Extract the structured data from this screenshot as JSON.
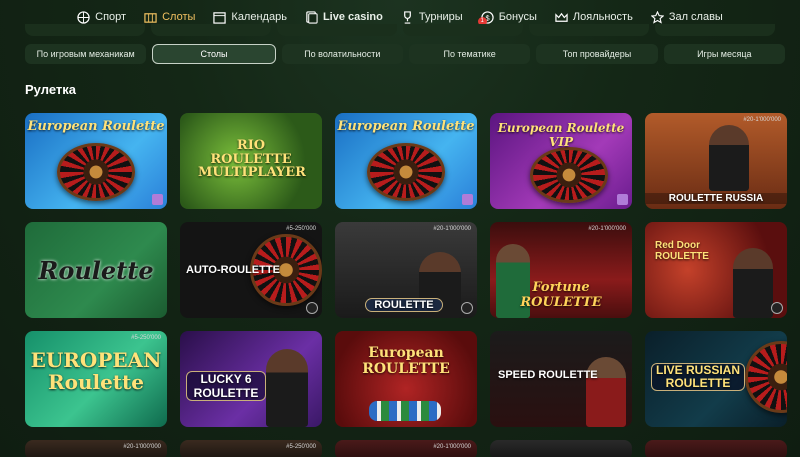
{
  "nav": {
    "items": [
      {
        "label": "Спорт",
        "icon": "ball-icon",
        "active": false
      },
      {
        "label": "Слоты",
        "icon": "slots-icon",
        "active": true
      },
      {
        "label": "Календарь",
        "icon": "calendar-icon",
        "active": false
      },
      {
        "label": "Live casino",
        "icon": "live-icon",
        "active": false,
        "bold": true
      },
      {
        "label": "Турниры",
        "icon": "trophy-icon",
        "active": false
      },
      {
        "label": "Бонусы",
        "icon": "bonus-icon",
        "active": false,
        "badge": "1"
      },
      {
        "label": "Лояльность",
        "icon": "crown-icon",
        "active": false
      },
      {
        "label": "Зал славы",
        "icon": "star-icon",
        "active": false
      }
    ]
  },
  "filters": [
    {
      "label": "По игровым механикам",
      "active": false
    },
    {
      "label": "Столы",
      "active": true
    },
    {
      "label": "По волатильности",
      "active": false
    },
    {
      "label": "По тематике",
      "active": false
    },
    {
      "label": "Топ провайдеры",
      "active": false
    },
    {
      "label": "Игры месяца",
      "active": false
    }
  ],
  "section": {
    "title": "Рулетка"
  },
  "games": [
    {
      "title": "European Roulette",
      "limit": ""
    },
    {
      "title": "RIO ROULETTE MULTIPLAYER",
      "limit": ""
    },
    {
      "title": "European Roulette",
      "limit": ""
    },
    {
      "title": "European Roulette VIP",
      "limit": ""
    },
    {
      "title": "ROULETTE RUSSIA",
      "limit": "#20-1'000'000"
    },
    {
      "title": "Roulette",
      "limit": ""
    },
    {
      "title": "AUTO-ROULETTE",
      "limit": "#5-250'000"
    },
    {
      "title": "ROULETTE",
      "limit": "#20-1'000'000"
    },
    {
      "title": "Fortune ROULETTE",
      "limit": "#20-1'000'000"
    },
    {
      "title": "Red Door ROULETTE",
      "limit": ""
    },
    {
      "title": "EUROPEAN Roulette",
      "limit": "#5-250'000"
    },
    {
      "title": "LUCKY 6 ROULETTE",
      "limit": ""
    },
    {
      "title": "European ROULETTE",
      "limit": ""
    },
    {
      "title": "SPEED ROULETTE",
      "limit": ""
    },
    {
      "title": "LIVE RUSSIAN ROULETTE",
      "limit": ""
    }
  ],
  "row4_limits": [
    "#20-1'000'000",
    "#5-250'000",
    "#20-1'000'000"
  ]
}
